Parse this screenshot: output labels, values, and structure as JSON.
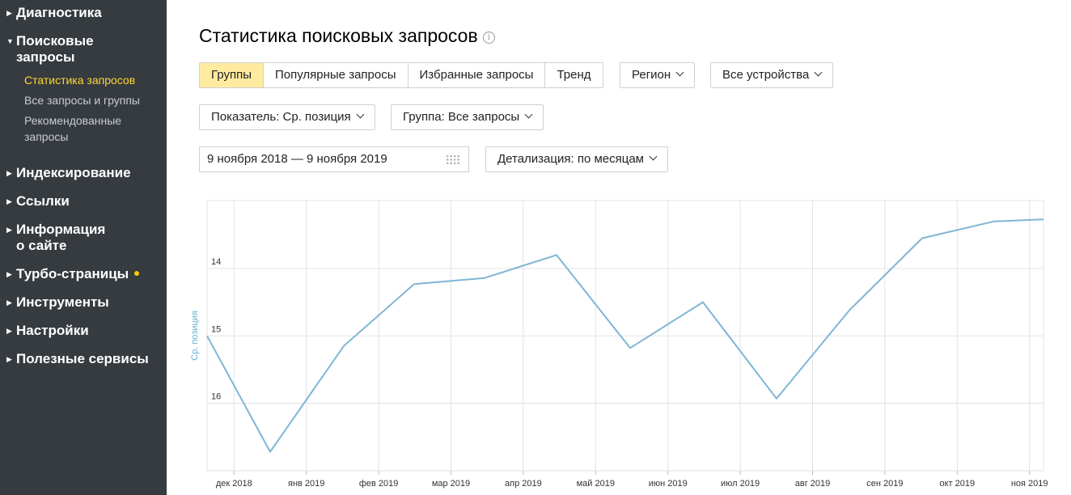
{
  "sidebar": {
    "items": [
      {
        "label": "Диагностика"
      },
      {
        "label": "Поисковые запросы",
        "sub": [
          "Статистика запросов",
          "Все запросы и группы",
          "Рекомендованные запросы"
        ]
      },
      {
        "label": "Индексирование"
      },
      {
        "label": "Ссылки"
      },
      {
        "label": "Информация о сайте"
      },
      {
        "label": "Турбо-страницы"
      },
      {
        "label": "Инструменты"
      },
      {
        "label": "Настройки"
      },
      {
        "label": "Полезные сервисы"
      }
    ],
    "active_sub": "Статистика запросов",
    "colors": {
      "bg": "#363b40",
      "active": "#ffd630",
      "dot": "#ffcc00"
    }
  },
  "page": {
    "title": "Статистика поисковых запросов",
    "info_icon": "i"
  },
  "tabs": [
    "Группы",
    "Популярные запросы",
    "Избранные запросы",
    "Тренд"
  ],
  "active_tab": "Группы",
  "filters": {
    "region": "Регион",
    "devices": "Все устройства",
    "metric": "Показатель: Ср. позиция",
    "group": "Группа: Все запросы",
    "date_range": "9 ноября 2018 — 9 ноября 2019",
    "detail": "Детализация: по месяцам"
  },
  "chart_data": {
    "type": "line",
    "ylabel": "Ср. позиция",
    "y_inverted": true,
    "ylim": [
      13.1,
      17.0
    ],
    "yticks": [
      14,
      15,
      16
    ],
    "xticks": [
      "дек 2018",
      "янв 2019",
      "фев 2019",
      "мар 2019",
      "апр 2019",
      "май 2019",
      "июн 2019",
      "июл 2019",
      "авг 2019",
      "сен 2019",
      "окт 2019",
      "ноя 2019"
    ],
    "x": [
      "ноя 2018",
      "дек 2018",
      "янв 2019",
      "фев 2019",
      "мар 2019",
      "апр 2019",
      "май 2019",
      "июн 2019",
      "июл 2019",
      "авг 2019",
      "сен 2019",
      "окт 2019",
      "ноя 2019"
    ],
    "values": [
      15.0,
      16.72,
      15.15,
      14.23,
      14.14,
      13.8,
      15.18,
      14.5,
      15.93,
      14.62,
      13.55,
      13.3,
      13.27
    ],
    "grid": true,
    "line_color": "#7fb6d4"
  }
}
